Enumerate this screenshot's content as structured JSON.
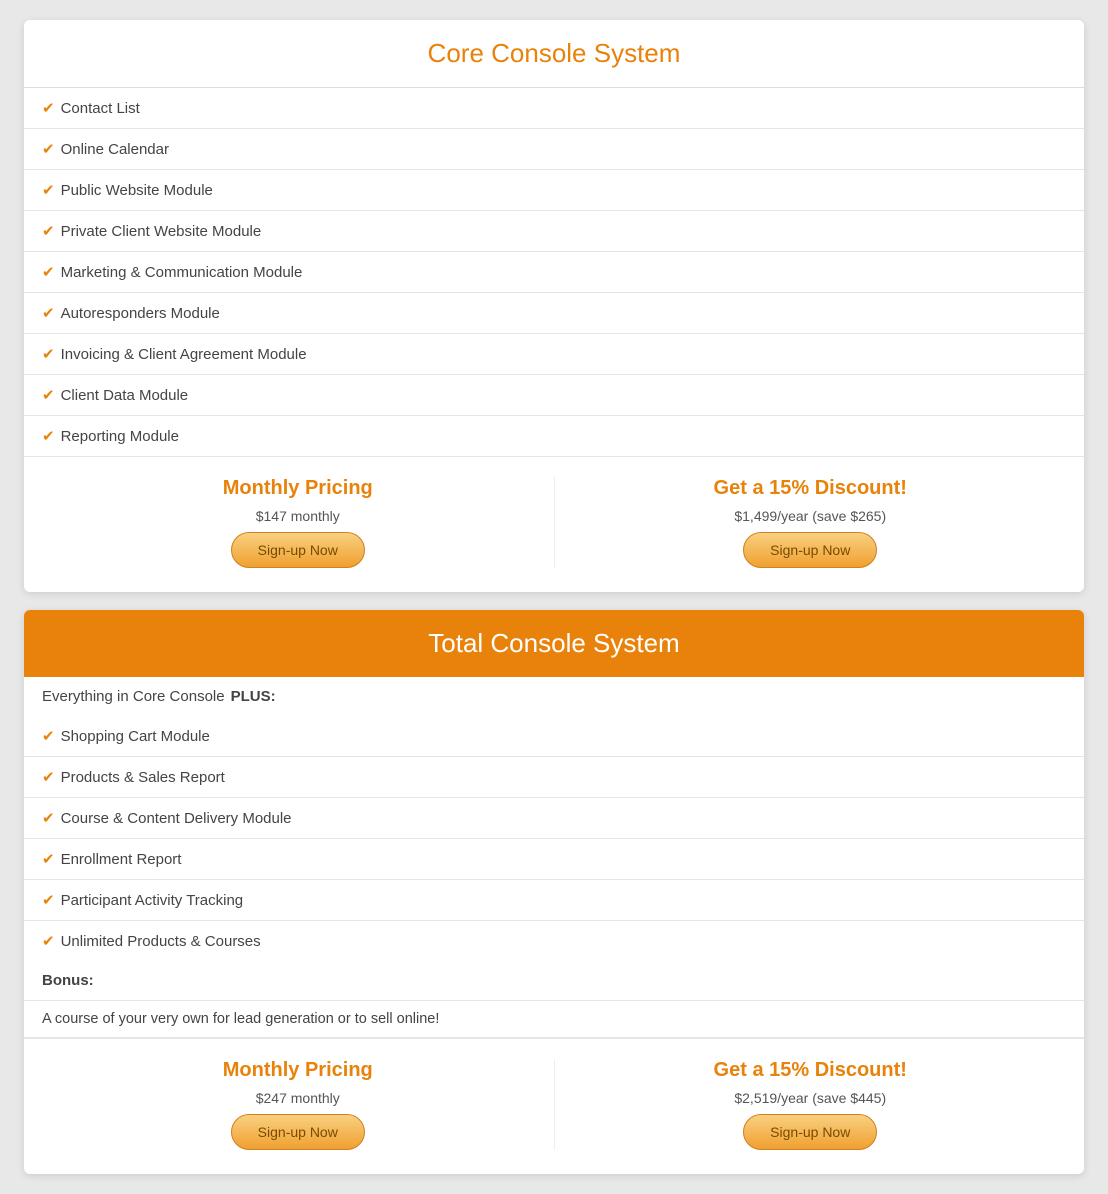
{
  "core_console": {
    "title": "Core Console System",
    "features": [
      "Contact List",
      "Online Calendar",
      "Public Website Module",
      "Private Client Website Module",
      "Marketing & Communication Module",
      "Autoresponders Module",
      "Invoicing & Client Agreement Module",
      "Client Data Module",
      "Reporting Module"
    ],
    "monthly_pricing": {
      "label": "Monthly Pricing",
      "amount": "$147 monthly",
      "button": "Sign-up Now"
    },
    "annual_pricing": {
      "label": "Get a 15% Discount!",
      "amount": "$1,499/year (save $265)",
      "button": "Sign-up Now"
    }
  },
  "total_console": {
    "title": "Total Console System",
    "intro": "Everything in Core Console ",
    "intro_bold": "PLUS:",
    "features": [
      "Shopping Cart Module",
      "Products & Sales Report",
      "Course & Content Delivery Module",
      "Enrollment Report",
      "Participant Activity Tracking",
      "Unlimited Products & Courses"
    ],
    "bonus_label": "Bonus:",
    "bonus_text": "A course of your very own for lead generation or to sell online!",
    "monthly_pricing": {
      "label": "Monthly Pricing",
      "amount": "$247 monthly",
      "button": "Sign-up Now"
    },
    "annual_pricing": {
      "label": "Get a 15% Discount!",
      "amount": "$2,519/year (save $445)",
      "button": "Sign-up Now"
    }
  }
}
